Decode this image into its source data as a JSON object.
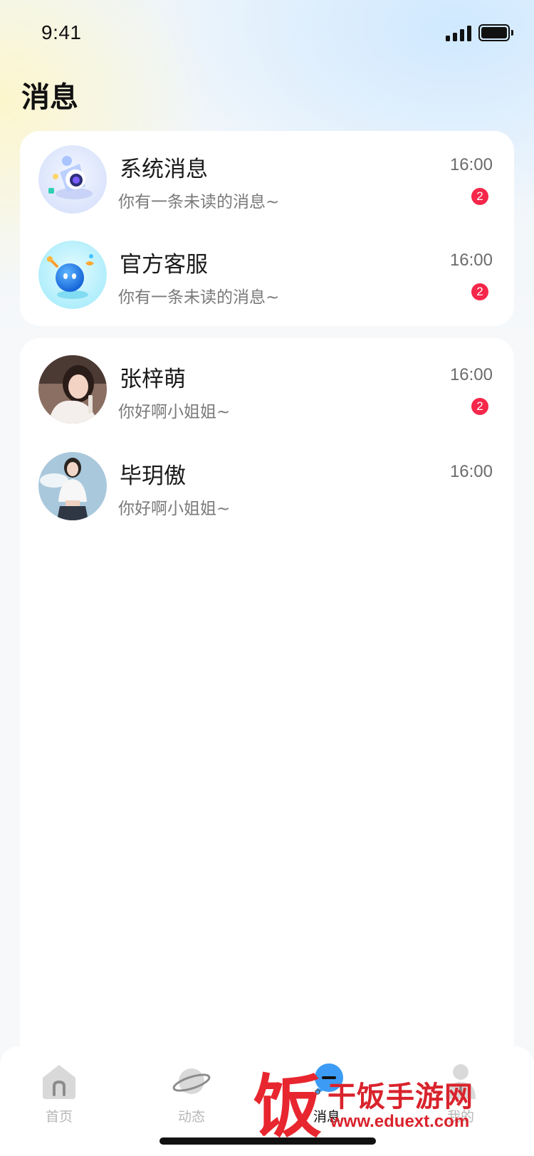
{
  "status_bar": {
    "time": "9:41",
    "signal_icon": "signal-bars-icon",
    "battery_icon": "battery-full-icon"
  },
  "header": {
    "title": "消息"
  },
  "system_threads": [
    {
      "name": "系统消息",
      "preview": "你有一条未读的消息~",
      "time": "16:00",
      "unread": "2",
      "avatar": "bell-illustration-icon"
    },
    {
      "name": "官方客服",
      "preview": "你有一条未读的消息~",
      "time": "16:00",
      "unread": "2",
      "avatar": "robot-mascot-icon"
    }
  ],
  "chats": [
    {
      "name": "张梓萌",
      "preview": "你好啊小姐姐~",
      "time": "16:00",
      "unread": "2",
      "avatar": "user-photo"
    },
    {
      "name": "毕玥傲",
      "preview": "你好啊小姐姐~",
      "time": "16:00",
      "unread": "",
      "avatar": "user-photo"
    }
  ],
  "tab_bar": {
    "tabs": [
      {
        "label": "首页",
        "icon": "home-icon",
        "active": false
      },
      {
        "label": "动态",
        "icon": "planet-icon",
        "active": false
      },
      {
        "label": "消息",
        "icon": "message-bubble-icon",
        "active": true
      },
      {
        "label": "我的",
        "icon": "profile-icon",
        "active": false
      }
    ]
  },
  "watermark": {
    "glyph": "饭",
    "title": "干饭手游网",
    "url": "www.eduext.com"
  },
  "colors": {
    "badge": "#f5274a",
    "accent": "#3b9bf5",
    "watermark": "#d9232c"
  }
}
